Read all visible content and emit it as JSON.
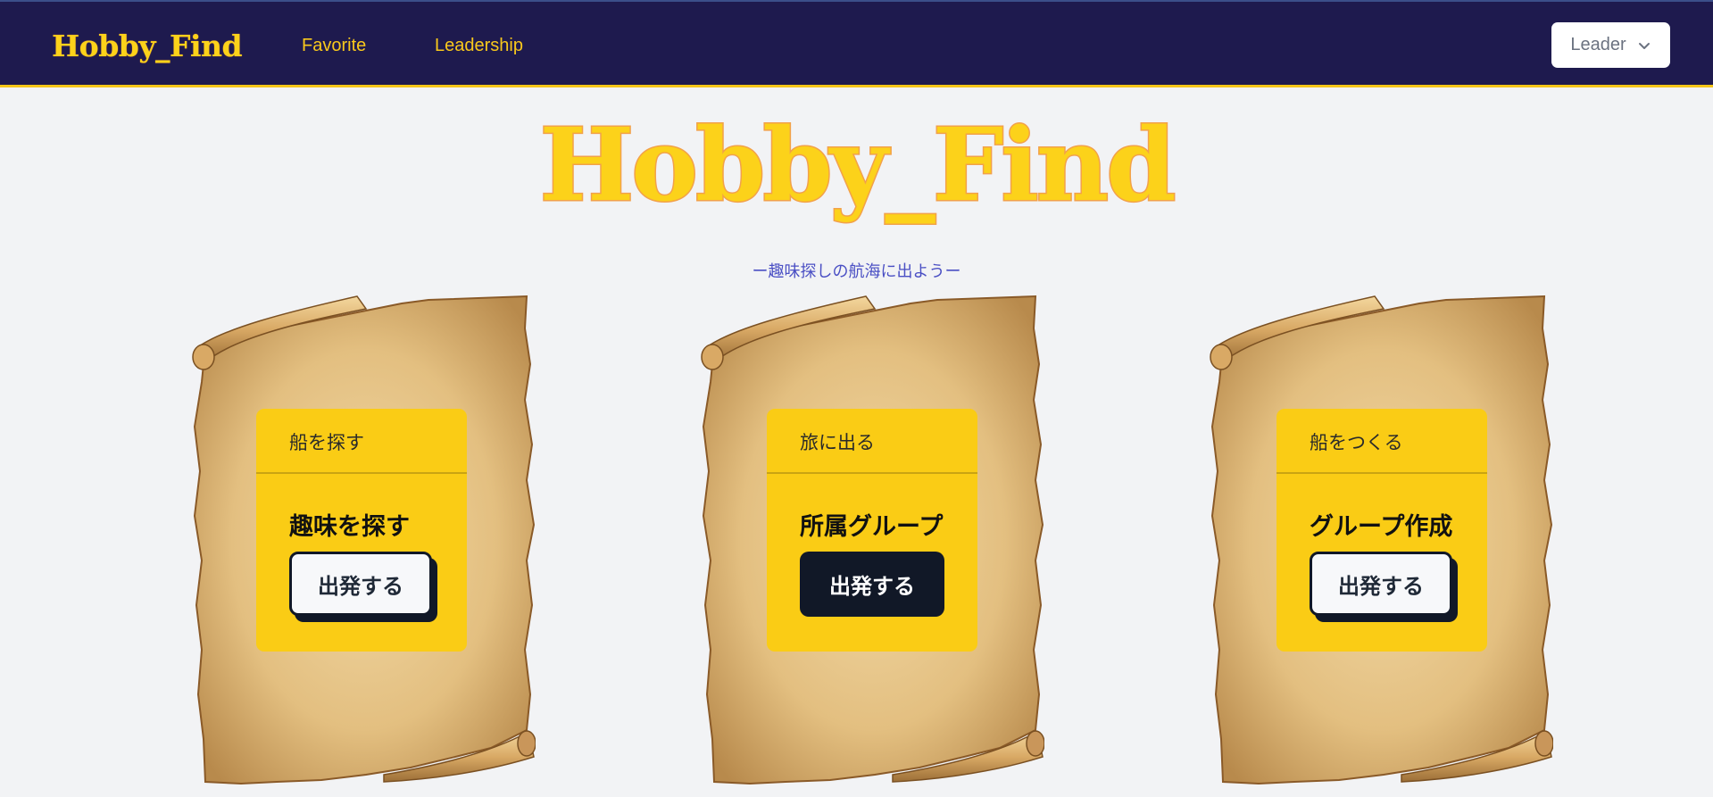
{
  "header": {
    "logo": "Hobby_Find",
    "nav": [
      {
        "label": "Favorite"
      },
      {
        "label": "Leadership"
      }
    ],
    "user_menu": {
      "label": "Leader"
    }
  },
  "hero": {
    "title": "Hobby_Find",
    "subtitle": "ー趣味探しの航海に出ようー"
  },
  "cards": [
    {
      "header": "船を探す",
      "title": "趣味を探す",
      "button": "出発する",
      "button_style": "light"
    },
    {
      "header": "旅に出る",
      "title": "所属グループ",
      "button": "出発する",
      "button_style": "dark"
    },
    {
      "header": "船をつくる",
      "title": "グループ作成",
      "button": "出発する",
      "button_style": "light"
    }
  ],
  "colors": {
    "navbar_bg": "#1e1a4e",
    "brand_yellow": "#fcd21a",
    "card_yellow": "#facc15",
    "dark_button": "#111827",
    "subtitle": "#4a4fc4",
    "page_bg": "#f2f3f5"
  }
}
